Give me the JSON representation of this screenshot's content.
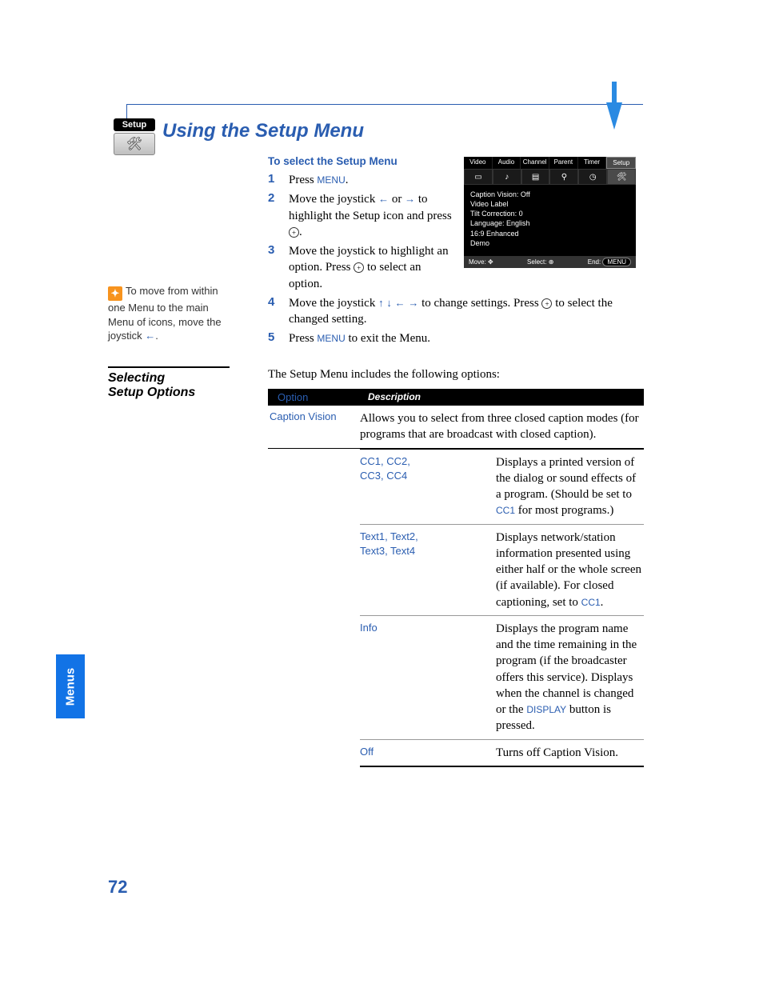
{
  "header": {
    "badge_label": "Setup",
    "title": "Using the Setup Menu"
  },
  "tip": {
    "text_parts": [
      "To move from within one Menu to the main Menu of icons, move the joystick ",
      "."
    ]
  },
  "instructions": {
    "heading": "To select the Setup Menu",
    "steps": [
      {
        "n": "1",
        "pre": "Press ",
        "kw": "MENU",
        "post": "."
      },
      {
        "n": "2",
        "text": "Move the joystick ← or → to highlight the Setup icon and press ⊕."
      },
      {
        "n": "3",
        "text": "Move the joystick to highlight an option. Press ⊕ to select an option."
      },
      {
        "n": "4",
        "text": "Move the joystick ↑ ↓ ← → to change settings. Press ⊕ to select the changed setting."
      },
      {
        "n": "5",
        "pre": "Press ",
        "kw": "MENU",
        "post": " to exit the Menu."
      }
    ]
  },
  "tv": {
    "tabs": [
      "Video",
      "Audio",
      "Channel",
      "Parent",
      "Timer",
      "Setup"
    ],
    "lines": [
      "Caption Vision: Off",
      "Video Label",
      "Tilt Correction: 0",
      "Language: English",
      "16:9 Enhanced",
      "Demo"
    ],
    "foot": {
      "move": "Move:",
      "select": "Select:",
      "end": "End:",
      "end_btn": "MENU"
    }
  },
  "section2": {
    "heading_l1": "Selecting",
    "heading_l2": "Setup Options",
    "intro": "The Setup Menu includes the following options:"
  },
  "table": {
    "hdr_option": "Option",
    "hdr_desc": "Description",
    "option": "Caption Vision",
    "option_desc": "Allows you to select from three closed caption modes (for programs that are broadcast with closed caption).",
    "rows": [
      {
        "k": "CC1, CC2,\nCC3, CC4",
        "v_pre": "Displays a printed version of the dialog or sound effects of a program. (Should be set to ",
        "v_kw": "CC1",
        "v_post": " for most programs.)"
      },
      {
        "k": "Text1, Text2,\nText3, Text4",
        "v_pre": "Displays network/station information presented using either half or the whole screen (if available). For closed captioning, set to ",
        "v_kw": "CC1",
        "v_post": "."
      },
      {
        "k": "Info",
        "v_pre": "Displays the program name and the time remaining in the program (if the broadcaster offers this service). Displays when the channel is changed or the ",
        "v_kw": "DISPLAY",
        "v_post": " button is pressed."
      },
      {
        "k": "Off",
        "v_pre": "Turns off Caption Vision.",
        "v_kw": "",
        "v_post": ""
      }
    ]
  },
  "footer": {
    "side_tab": "Menus",
    "page": "72"
  }
}
